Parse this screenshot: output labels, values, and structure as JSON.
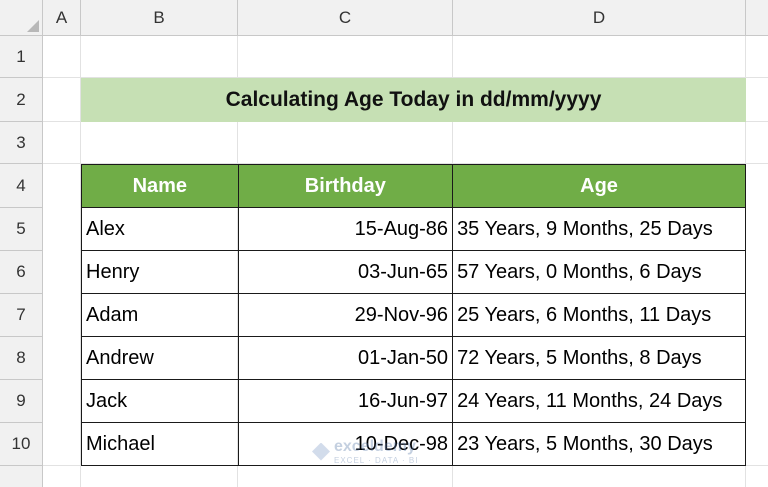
{
  "columns": [
    "A",
    "B",
    "C",
    "D"
  ],
  "rows": [
    "1",
    "2",
    "3",
    "4",
    "5",
    "6",
    "7",
    "8",
    "9",
    "10"
  ],
  "title": "Calculating Age Today in dd/mm/yyyy",
  "table": {
    "headers": {
      "name": "Name",
      "birthday": "Birthday",
      "age": "Age"
    },
    "rows": [
      {
        "name": "Alex",
        "birthday": "15-Aug-86",
        "age": "35 Years, 9 Months, 25 Days"
      },
      {
        "name": "Henry",
        "birthday": "03-Jun-65",
        "age": "57 Years, 0 Months, 6 Days"
      },
      {
        "name": "Adam",
        "birthday": "29-Nov-96",
        "age": "25 Years, 6 Months, 11 Days"
      },
      {
        "name": "Andrew",
        "birthday": "01-Jan-50",
        "age": "72 Years, 5 Months, 8 Days"
      },
      {
        "name": "Jack",
        "birthday": "16-Jun-97",
        "age": "24 Years, 11 Months, 24 Days"
      },
      {
        "name": "Michael",
        "birthday": "10-Dec-98",
        "age": "23 Years, 5 Months, 30 Days"
      }
    ]
  },
  "watermark": {
    "brand": "exceldemy",
    "tagline": "EXCEL · DATA · BI"
  },
  "colors": {
    "header_green": "#70ad47",
    "title_green": "#c6e0b4"
  }
}
